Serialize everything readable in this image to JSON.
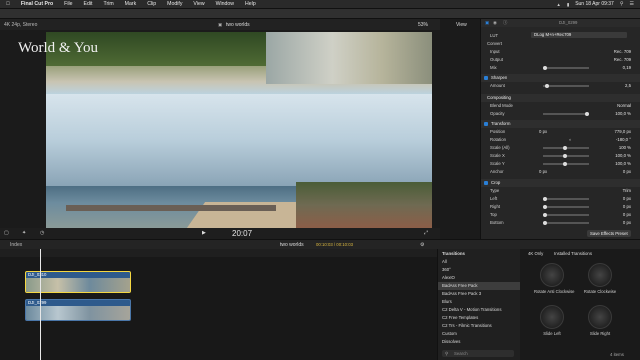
{
  "menubar": {
    "apple": "",
    "items": [
      "Final Cut Pro",
      "File",
      "Edit",
      "Trim",
      "Mark",
      "Clip",
      "Modify",
      "View",
      "Window",
      "Help"
    ],
    "date_time": "Sun 18 Apr  09:37"
  },
  "viewer": {
    "format": "4K 24p, Stereo",
    "project": "two worlds",
    "zoom": "53%",
    "view": "View",
    "title_overlay": "World & You",
    "timecode": "20:07"
  },
  "inspector": {
    "clip_name": "DJI_0299",
    "lut_label": "LUT",
    "lut_value": "DLog M+n+Rec709",
    "convert": "Convert",
    "input_label": "Input",
    "input_value": "Rec. 709",
    "output_label": "Output",
    "output_value": "Rec. 709",
    "mix_label": "Mix",
    "mix_value": "0,19",
    "sharpen": "Sharpen",
    "amount_label": "Amount",
    "amount_value": "2,5",
    "compositing": "Compositing",
    "blend_label": "Blend Mode",
    "blend_value": "Normal",
    "opacity_label": "Opacity",
    "opacity_value": "100,0 %",
    "transform": "Transform",
    "position_label": "Position",
    "position_x": "0 px",
    "position_y": "779,0 px",
    "rotation_label": "Rotation",
    "rotation_value": "-180,0 °",
    "scale_all_label": "Scale (All)",
    "scale_all_value": "100 %",
    "scale_x_label": "Scale X",
    "scale_x_value": "100,0 %",
    "scale_y_label": "Scale Y",
    "scale_y_value": "100,0 %",
    "anchor_label": "Anchor",
    "anchor_x": "0 px",
    "anchor_y": "0 px",
    "crop": "Crop",
    "type_label": "Type",
    "type_value": "Trim",
    "left_label": "Left",
    "left_value": "0 px",
    "right_label": "Right",
    "right_value": "0 px",
    "top_label": "Top",
    "top_value": "0 px",
    "bottom_label": "Bottom",
    "bottom_value": "0 px",
    "save_preset": "Save Effects Preset"
  },
  "timeline": {
    "index": "Index",
    "project": "two worlds",
    "duration": "00:10:03 / 00:10:03",
    "clip1": "DJI_0310",
    "clip2": "DJI_0299"
  },
  "browser": {
    "header": "Transitions",
    "items": [
      "All",
      "360°",
      "AlexIO",
      "BadAss Free Pack",
      "BadAss Free Pack 3",
      "Blurs",
      "C2 Delta V - Motion Transitions",
      "C2 Free Templates",
      "C2 Trs - Filmic Transitions",
      "Custom",
      "Dissolves"
    ],
    "selected_index": 3,
    "search_placeholder": "Search"
  },
  "effects": {
    "filter": "4K Only",
    "category": "Installed Transitions",
    "items": [
      "Rotate Anti Clockwise",
      "Rotate Clockwise",
      "Slide Left",
      "Slide Right"
    ],
    "count": "4 items"
  },
  "colors": {
    "accent": "#2a7fd6",
    "clip_selected_border": "#f5d742",
    "clip_blue": "#2e5a8c"
  }
}
